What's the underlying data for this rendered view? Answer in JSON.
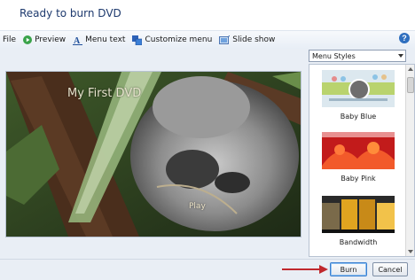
{
  "window": {
    "title": "Ready to burn DVD"
  },
  "toolbar": {
    "file": "File",
    "preview": "Preview",
    "menu_text": "Menu text",
    "customize_menu": "Customize menu",
    "slide_show": "Slide show",
    "help": "?"
  },
  "preview": {
    "dvd_title": "My First DVD",
    "play_label": "Play"
  },
  "menu_styles": {
    "selected": "Menu Styles",
    "items": [
      {
        "label": "Baby Blue"
      },
      {
        "label": "Baby Pink"
      },
      {
        "label": "Bandwidth"
      }
    ]
  },
  "buttons": {
    "burn": "Burn",
    "cancel": "Cancel"
  },
  "colors": {
    "accent": "#2f6fbf",
    "annotation_arrow": "#c0282d"
  }
}
